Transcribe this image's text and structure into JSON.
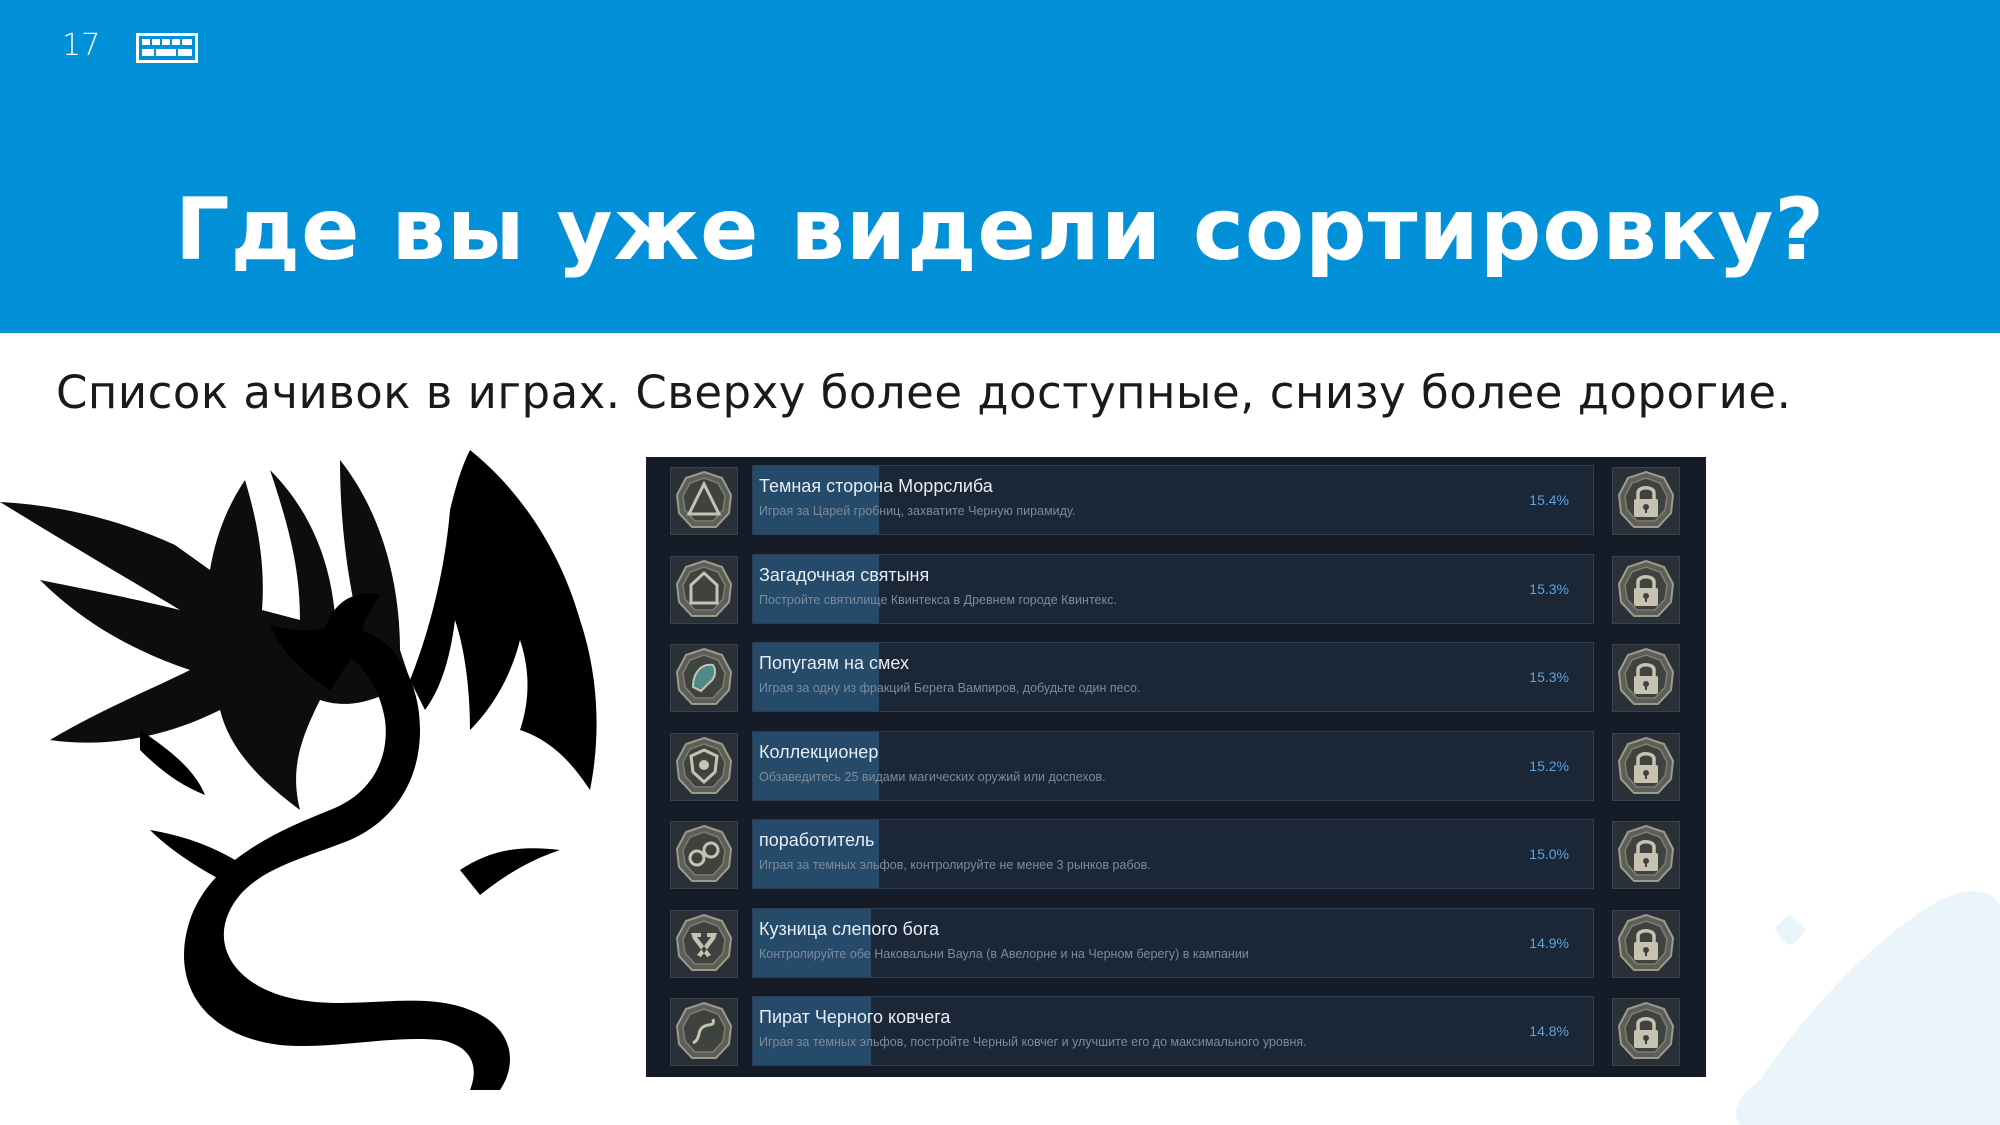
{
  "slide": {
    "number": "17",
    "title": "Где вы уже видели сортировку?",
    "subtitle": "Список ачивок в играх. Сверху более доступные, снизу более дорогие."
  },
  "colors": {
    "header_bg": "#0290d8",
    "panel_bg": "#151c27",
    "percent_text": "#5aa4e0"
  },
  "achievements": [
    {
      "name": "Темная сторона Моррслиба",
      "description": "Играя за Царей гробниц, захватите Черную пирамиду.",
      "percent": "15.4%",
      "progress": 0.15,
      "icon": "pyramid-icon"
    },
    {
      "name": "Загадочная святыня",
      "description": "Постройте святилище Квинтекса в Древнем городе Квинтекс.",
      "percent": "15.3%",
      "progress": 0.15,
      "icon": "shrine-icon"
    },
    {
      "name": "Попугаям на смех",
      "description": "Играя за одну из фракций Берега Вампиров, добудьте один песо.",
      "percent": "15.3%",
      "progress": 0.15,
      "icon": "parrot-icon"
    },
    {
      "name": "Коллекционер",
      "description": "Обзаведитесь 25 видами магических оружий или доспехов.",
      "percent": "15.2%",
      "progress": 0.15,
      "icon": "shield-icon"
    },
    {
      "name": "поработитель",
      "description": "Играя за темных эльфов, контролируйте не менее 3 рынков рабов.",
      "percent": "15.0%",
      "progress": 0.15,
      "icon": "shackles-icon"
    },
    {
      "name": "Кузница слепого бога",
      "description": "Контролируйте обе Наковальни Ваула (в Авелорне и на Черном берегу) в кампании",
      "percent": "14.9%",
      "progress": 0.14,
      "icon": "hammers-icon"
    },
    {
      "name": "Пират Черного ковчега",
      "description": "Играя за темных эльфов, постройте Черный ковчег и улучшите его до максимального уровня.",
      "percent": "14.8%",
      "progress": 0.14,
      "icon": "serpent-icon"
    }
  ],
  "lock_icon": "lock-icon"
}
